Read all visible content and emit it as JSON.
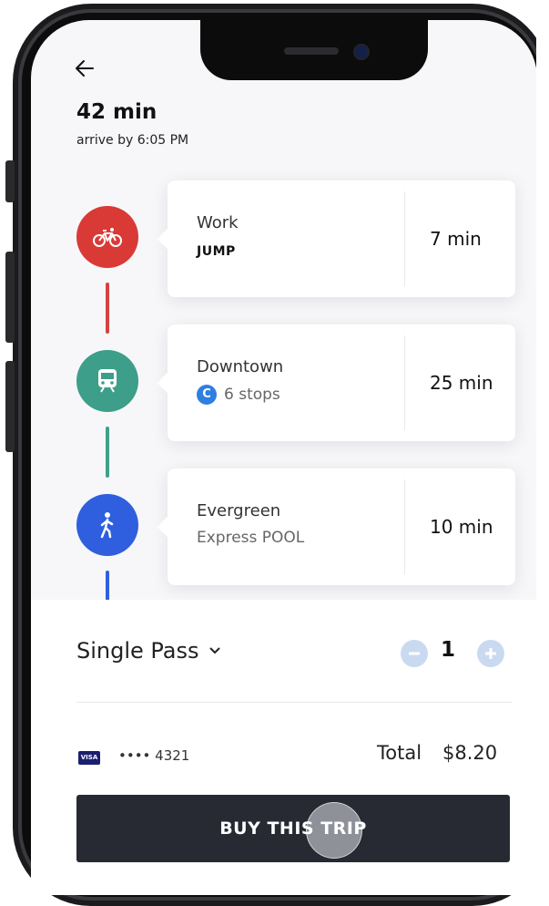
{
  "header": {
    "back_icon": "arrow-left-icon",
    "duration": "42 min",
    "arrive_by": "arrive by 6:05 PM"
  },
  "legs": [
    {
      "icon": "bicycle-icon",
      "color": "#d93a36",
      "title": "Work",
      "subtitle": "JUMP",
      "duration": "7 min"
    },
    {
      "icon": "train-icon",
      "color": "#3d9e8a",
      "title": "Downtown",
      "route_badge": "C",
      "subtitle": "6 stops",
      "duration": "25 min"
    },
    {
      "icon": "walking-icon",
      "color": "#2f5fdf",
      "title": "Evergreen",
      "subtitle": "Express POOL",
      "duration": "10 min"
    }
  ],
  "purchase": {
    "pass_type": "Single Pass",
    "quantity": "1",
    "card_brand": "VISA",
    "card_number": "•••• 4321",
    "total_label": "Total",
    "total_value": "$8.20",
    "buy_label": "BUY THIS TRIP"
  },
  "colors": {
    "bike": "#d93a36",
    "transit": "#3d9e8a",
    "walk": "#2f5fdf",
    "button": "#272a33"
  }
}
